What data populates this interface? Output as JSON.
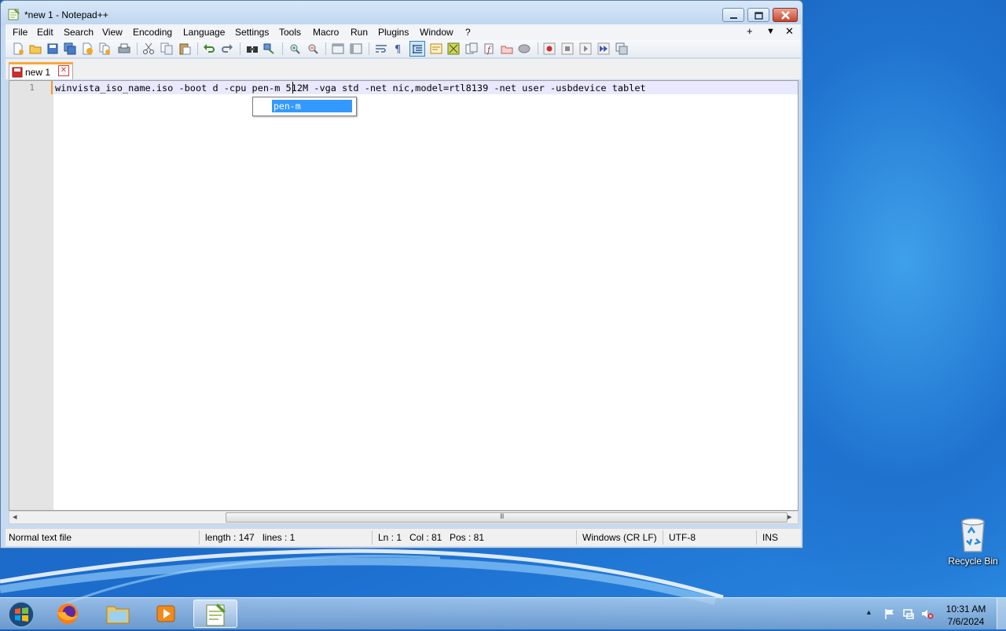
{
  "window": {
    "title": "*new 1 - Notepad++"
  },
  "menubar": {
    "items": [
      "File",
      "Edit",
      "Search",
      "View",
      "Encoding",
      "Language",
      "Settings",
      "Tools",
      "Macro",
      "Run",
      "Plugins",
      "Window",
      "?"
    ],
    "right_plus": "+",
    "right_down": "▼",
    "right_close": "✕"
  },
  "toolbar": {
    "icons": [
      "new-file-icon",
      "open-file-icon",
      "save-icon",
      "save-all-icon",
      "close-icon",
      "close-all-icon",
      "print-icon",
      "cut-icon",
      "copy-icon",
      "paste-icon",
      "undo-icon",
      "redo-icon",
      "find-icon",
      "replace-icon",
      "zoom-in-icon",
      "zoom-out-icon",
      "sync-vertical-icon",
      "sync-horizontal-icon",
      "word-wrap-icon",
      "show-all-chars-icon",
      "indent-guide-icon",
      "user-language-icon",
      "document-map-icon",
      "function-list-icon",
      "folder-as-workspace-icon",
      "monitoring-icon",
      "start-record-icon",
      "stop-record-icon",
      "playback-icon",
      "run-macro-multiple-icon",
      "save-macro-icon"
    ]
  },
  "tabs": [
    {
      "label": "new 1",
      "close": "✕"
    }
  ],
  "editor": {
    "line_number": "1",
    "text": "winvista_iso_name.iso -boot d -cpu pen-m 512M -vga std -net nic,model=rtl8139 -net user -usbdevice tablet",
    "autocomplete": [
      "pen-m"
    ]
  },
  "scrollbar": {
    "grip": "III",
    "left_arrow": "◂",
    "right_arrow": "▸"
  },
  "statusbar": {
    "file_type": "Normal text file",
    "length": "length : 147",
    "lines": "lines : 1",
    "ln": "Ln : 1",
    "col": "Col : 81",
    "pos": "Pos : 81",
    "eol": "Windows (CR LF)",
    "encoding": "UTF-8",
    "mode": "INS"
  },
  "desktop": {
    "recycle_bin": "Recycle Bin"
  },
  "taskbar": {
    "apps": [
      "firefox-icon",
      "file-explorer-icon",
      "media-player-icon",
      "notepad-plus-plus-icon"
    ],
    "tray_arrow": "▲",
    "time": "10:31 AM",
    "date": "7/6/2024"
  },
  "colors": {
    "accent": "#3399ff",
    "tab_highlight": "#f9a93c",
    "current_line": "#e8e8ff"
  }
}
